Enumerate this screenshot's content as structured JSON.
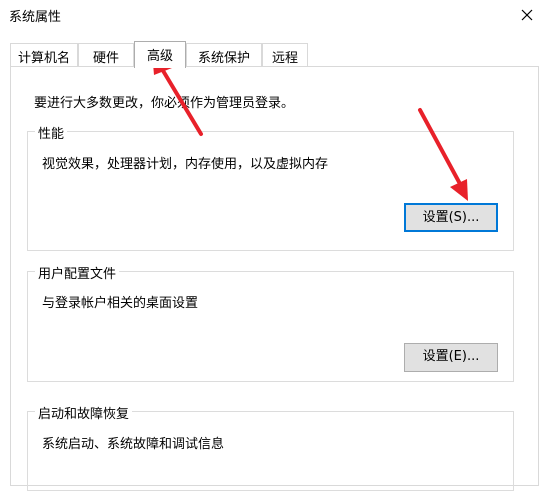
{
  "window": {
    "title": "系统属性",
    "close_icon": "close-icon"
  },
  "tabs": [
    {
      "label": "计算机名"
    },
    {
      "label": "硬件"
    },
    {
      "label": "高级",
      "active": true
    },
    {
      "label": "系统保护"
    },
    {
      "label": "远程"
    }
  ],
  "advanced": {
    "admin_notice": "要进行大多数更改，你必须作为管理员登录。",
    "performance": {
      "title": "性能",
      "description": "视觉效果，处理器计划，内存使用，以及虚拟内存",
      "settings_button": "设置(S)..."
    },
    "user_profiles": {
      "title": "用户配置文件",
      "description": "与登录帐户相关的桌面设置",
      "settings_button": "设置(E)..."
    },
    "startup_recovery": {
      "title": "启动和故障恢复",
      "description": "系统启动、系统故障和调试信息"
    }
  },
  "annotation_color": "#e8212a"
}
